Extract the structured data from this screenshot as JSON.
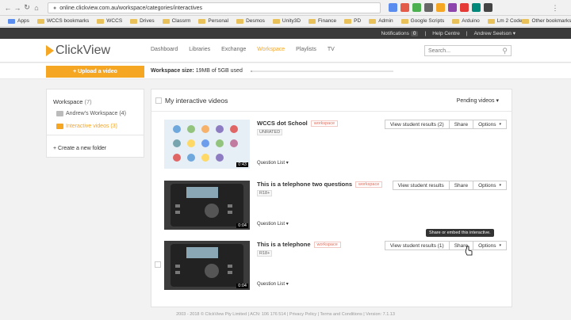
{
  "browser": {
    "url": "online.clickview.com.au/workspace/categories/interactives",
    "bookmarks": [
      "Apps",
      "WCCS bookmarks",
      "WCCS",
      "Drives",
      "Classrm",
      "Personal",
      "Desmos",
      "Unity3D",
      "Finance",
      "PD",
      "Admin",
      "Google Scripts",
      "Arduino",
      "Lm 2 Code",
      "Other bookmarks"
    ],
    "extensions": [
      {
        "label": "",
        "color": "#5b8def"
      },
      {
        "label": "",
        "color": "#e35c4a"
      },
      {
        "label": "",
        "color": "#4caf50"
      },
      {
        "label": "",
        "color": "#666666"
      },
      {
        "label": "",
        "color": "#f5a623"
      },
      {
        "label": "",
        "color": "#8e44ad"
      },
      {
        "label": "",
        "color": "#e53935"
      },
      {
        "label": "",
        "color": "#00897b"
      },
      {
        "label": "",
        "color": "#444444"
      }
    ]
  },
  "topbar": {
    "notifications_label": "Notifications",
    "notifications_count": "0",
    "help": "Help Centre",
    "user": "Andrew Seelson"
  },
  "header": {
    "logo": "ClickView",
    "nav": [
      "Dashboard",
      "Libraries",
      "Exchange",
      "Workspace",
      "Playlists",
      "TV"
    ],
    "active_nav": "Workspace",
    "search_placeholder": "Search..."
  },
  "upload": {
    "button_label": "+ Upload a video",
    "size_label": "Workspace size:",
    "size_value": "19MB of 5GB used",
    "used_fraction": 0.004
  },
  "sidebar": {
    "title": "Workspace",
    "title_count": "(7)",
    "items": [
      {
        "label": "Andrew's Workspace (4)",
        "active": false
      },
      {
        "label": "Interactive videos (3)",
        "active": true
      }
    ],
    "create_label": "+ Create a new folder"
  },
  "main": {
    "title": "My interactive videos",
    "sort_label": "Pending videos",
    "rows": [
      {
        "title": "WCCS dot School",
        "tag": "workspace",
        "rating": "UNRATED",
        "duration": "0:43",
        "question_list": "Question List",
        "results_label": "View student results (2)",
        "share_label": "Share",
        "options_label": "Options"
      },
      {
        "title": "This is a telephone two questions",
        "tag": "workspace",
        "rating": "R18+",
        "duration": "0:04",
        "question_list": "Question List",
        "results_label": "View student results",
        "share_label": "Share",
        "options_label": "Options"
      },
      {
        "title": "This is a telephone",
        "tag": "workspace",
        "rating": "R18+",
        "duration": "0:04",
        "question_list": "Question List",
        "results_label": "View student results (1)",
        "share_label": "Share",
        "options_label": "Options"
      }
    ],
    "tooltip": "Share or embed this interactive."
  },
  "footer": "2003 - 2018 © ClickView Pty Limited | ACN: 106 176 514 | Privacy Policy | Terms and Conditions | Version: 7.1.13",
  "colors": {
    "accent": "#f5a623",
    "dark_bar": "#3a3a3a"
  }
}
